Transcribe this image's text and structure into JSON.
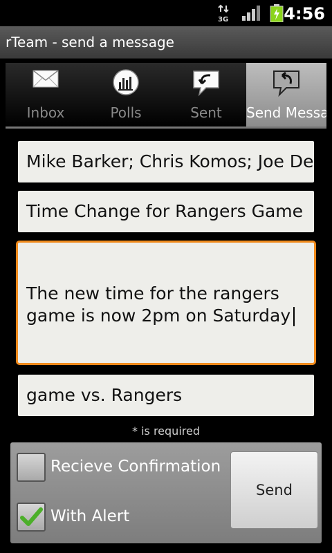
{
  "status_bar": {
    "time": "4:56",
    "network": "3G"
  },
  "app": {
    "title": "rTeam - send a message"
  },
  "tabs": [
    {
      "label": "Inbox",
      "icon": "envelope-icon",
      "active": false
    },
    {
      "label": "Polls",
      "icon": "bar-chart-icon",
      "active": false
    },
    {
      "label": "Sent",
      "icon": "chat-bubble-arrow-icon",
      "active": false
    },
    {
      "label": "Send Message",
      "icon": "reply-bubble-icon",
      "active": true
    }
  ],
  "form": {
    "recipients": "Mike Barker; Chris Komos; Joe Dean",
    "subject": "Time Change for Rangers Game",
    "body": "The new time for the rangers game is now 2pm on Saturday",
    "event": "game vs. Rangers",
    "required_note": "* is required"
  },
  "options": {
    "receive_confirmation": {
      "label": "Recieve Confirmation",
      "checked": false
    },
    "with_alert": {
      "label": "With Alert",
      "checked": true
    }
  },
  "send_label": "Send",
  "colors": {
    "focus_border": "#f08a1c",
    "check": "#4caf2a",
    "battery": "#8bd41b"
  }
}
